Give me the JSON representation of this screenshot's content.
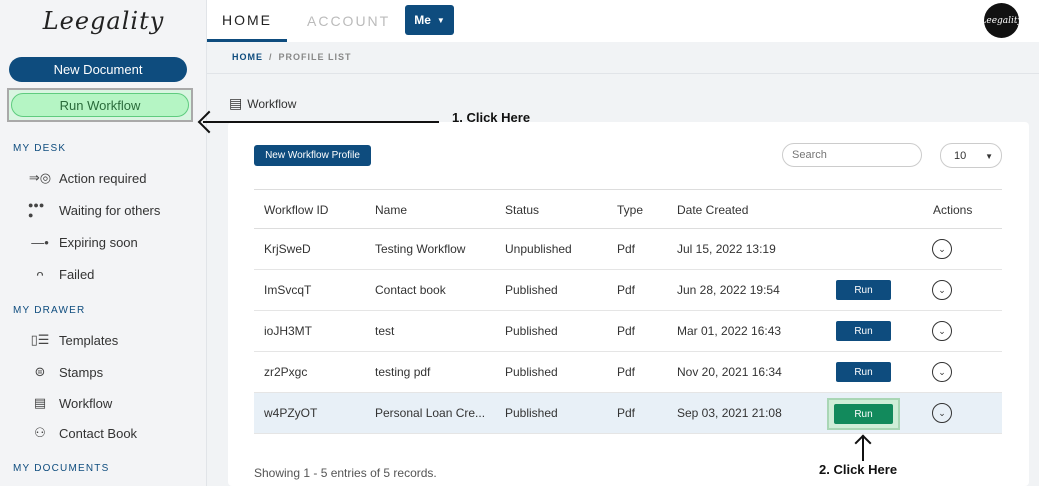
{
  "sidebar": {
    "logo": "Leegality",
    "new_document": "New Document",
    "run_workflow": "Run Workflow",
    "my_desk": "MY DESK",
    "desk_items": [
      {
        "label": "Action required",
        "icon": "arrow-target-icon"
      },
      {
        "label": "Waiting for others",
        "icon": "dots-icon"
      },
      {
        "label": "Expiring soon",
        "icon": "line-icon"
      },
      {
        "label": "Failed",
        "icon": "failed-icon"
      }
    ],
    "my_drawer": "MY DRAWER",
    "drawer_items": [
      {
        "label": "Templates",
        "icon": "template-icon"
      },
      {
        "label": "Stamps",
        "icon": "stamp-icon"
      },
      {
        "label": "Workflow",
        "icon": "document-icon"
      },
      {
        "label": "Contact Book",
        "icon": "contacts-icon"
      }
    ],
    "my_documents": "MY DOCUMENTS"
  },
  "header": {
    "tabs": [
      "HOME",
      "ACCOUNT"
    ],
    "me": "Me",
    "avatar_text": "Leegality"
  },
  "breadcrumb": {
    "home": "HOME",
    "current": "PROFILE LIST"
  },
  "page_title": "Workflow",
  "toolbar": {
    "new_profile": "New Workflow Profile",
    "search_placeholder": "Search",
    "page_size": "10"
  },
  "table": {
    "headers": [
      "Workflow ID",
      "Name",
      "Status",
      "Type",
      "Date Created",
      "Actions"
    ],
    "rows": [
      {
        "id": "KrjSweD",
        "name": "Testing Workflow",
        "status": "Unpublished",
        "type": "Pdf",
        "date": "Jul 15, 2022 13:19",
        "run": ""
      },
      {
        "id": "ImSvcqT",
        "name": "Contact book",
        "status": "Published",
        "type": "Pdf",
        "date": "Jun 28, 2022 19:54",
        "run": "Run"
      },
      {
        "id": "ioJH3MT",
        "name": "test",
        "status": "Published",
        "type": "Pdf",
        "date": "Mar 01, 2022 16:43",
        "run": "Run"
      },
      {
        "id": "zr2Pxgc",
        "name": "testing pdf",
        "status": "Published",
        "type": "Pdf",
        "date": "Nov 20, 2021 16:34",
        "run": "Run"
      },
      {
        "id": "w4PZyOT",
        "name": "Personal Loan Cre...",
        "status": "Published",
        "type": "Pdf",
        "date": "Sep 03, 2021 21:08",
        "run": "Run"
      }
    ]
  },
  "footer": {
    "showing": "Showing 1 - 5 entries of 5 records."
  },
  "annotations": {
    "step1": "1. Click Here",
    "step2": "2. Click Here"
  },
  "colors": {
    "primary": "#0e4c7e",
    "run_highlight": "#128a5c",
    "run_workflow_bg": "#b5f5c4"
  }
}
